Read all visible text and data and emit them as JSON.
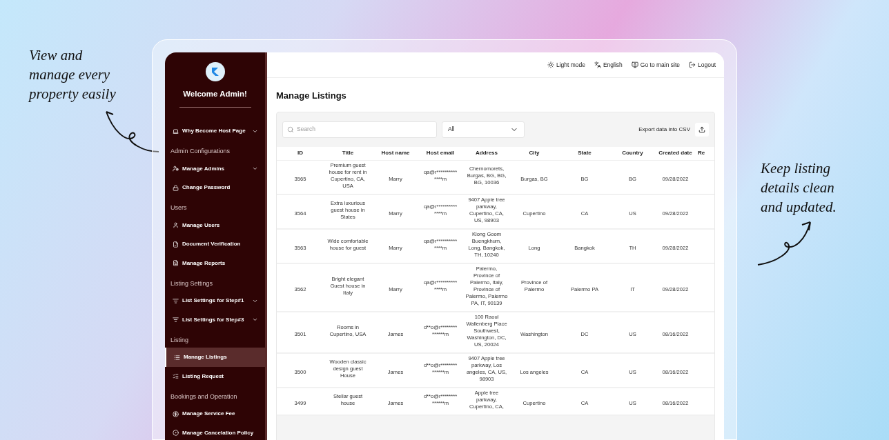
{
  "callouts": [
    {
      "text": "View and manage every property easily"
    },
    {
      "text": "Keep listing details clean and updated."
    }
  ],
  "sidebar": {
    "title": "Welcome Admin!",
    "sections": [
      {
        "items": [
          {
            "label": "Why Become Host Page",
            "expandable": true,
            "selected": false
          }
        ]
      },
      {
        "heading": "Admin Configurations",
        "items": [
          {
            "label": "Manage Admins",
            "expandable": true,
            "selected": false
          },
          {
            "label": "Change Password",
            "expandable": false,
            "selected": false
          }
        ]
      },
      {
        "heading": "Users",
        "items": [
          {
            "label": "Manage Users",
            "expandable": false,
            "selected": false
          },
          {
            "label": "Document Verification",
            "expandable": false,
            "selected": false
          },
          {
            "label": "Manage Reports",
            "expandable": false,
            "selected": false
          }
        ]
      },
      {
        "heading": "Listing Settings",
        "items": [
          {
            "label": "List Settings for Step#1",
            "expandable": true,
            "selected": false
          },
          {
            "label": "List Settings for Step#3",
            "expandable": true,
            "selected": false
          }
        ]
      },
      {
        "heading": "Listing",
        "items": [
          {
            "label": "Manage Listings",
            "expandable": false,
            "selected": true
          },
          {
            "label": "Listing Request",
            "expandable": false,
            "selected": false
          }
        ]
      },
      {
        "heading": "Bookings and Operation",
        "items": [
          {
            "label": "Manage Service Fee",
            "expandable": false,
            "selected": false
          },
          {
            "label": "Manage Cancelation Policy",
            "expandable": false,
            "selected": false
          }
        ]
      }
    ]
  },
  "top_bar": [
    "Light mode",
    "English",
    "Go to main site",
    "Logout"
  ],
  "page_title": "Manage Listings",
  "search": {
    "placeholder": "Search"
  },
  "filter": {
    "value": "All"
  },
  "export_label": "Export data into CSV",
  "table": {
    "columns": [
      "ID",
      "Title",
      "Host name",
      "Host email",
      "Address",
      "City",
      "State",
      "Country",
      "Created date",
      "Re"
    ],
    "rows": [
      [
        "3565",
        "Premium guest house for rent in Cupertino, CA, USA",
        "Marry",
        "qa@r**************m",
        "Chernomorets, Burgas, BG, BG, BG, 10036",
        "Burgas, BG",
        "BG",
        "BG",
        "09/28/2022"
      ],
      [
        "3564",
        "Extra luxurious guest house in States",
        "Marry",
        "qa@r**************m",
        "9407 Apple tree parkway, Cupertino, CA, US, 98903",
        "Cupertino",
        "CA",
        "US",
        "09/28/2022"
      ],
      [
        "3563",
        "Wide comfortable house for guest",
        "Marry",
        "qa@r**************m",
        "Klong Goom Buengkhum, Long, Bangkok, TH, 10240",
        "Long",
        "Bangkok",
        "TH",
        "09/28/2022"
      ],
      [
        "3562",
        "Bright elegant Guest house in Italy",
        "Marry",
        "qa@r**************m",
        "Palermo, Province of Palermo, Italy, Province of Palermo, Palermo PA, IT, 90139",
        "Province of Palermo",
        "Palermo PA",
        "IT",
        "09/28/2022"
      ],
      [
        "3501",
        "Rooms in Cupertino, USA",
        "James",
        "d**o@r**************m",
        "100 Raoul Wallenberg Place Southwest, Washington, DC, US, 20024",
        "Washington",
        "DC",
        "US",
        "08/16/2022"
      ],
      [
        "3500",
        "Wooden classic design guest House",
        "James",
        "d**o@r**************m",
        "9407 Apple tree parkway, Los angeles, CA, US, 98903",
        "Los angeles",
        "CA",
        "US",
        "08/16/2022"
      ],
      [
        "3499",
        "Stellar guest house",
        "James",
        "d**o@r**************m",
        "Apple tree parkway, Cupertino, CA,",
        "Cupertino",
        "CA",
        "US",
        "08/16/2022"
      ]
    ]
  }
}
